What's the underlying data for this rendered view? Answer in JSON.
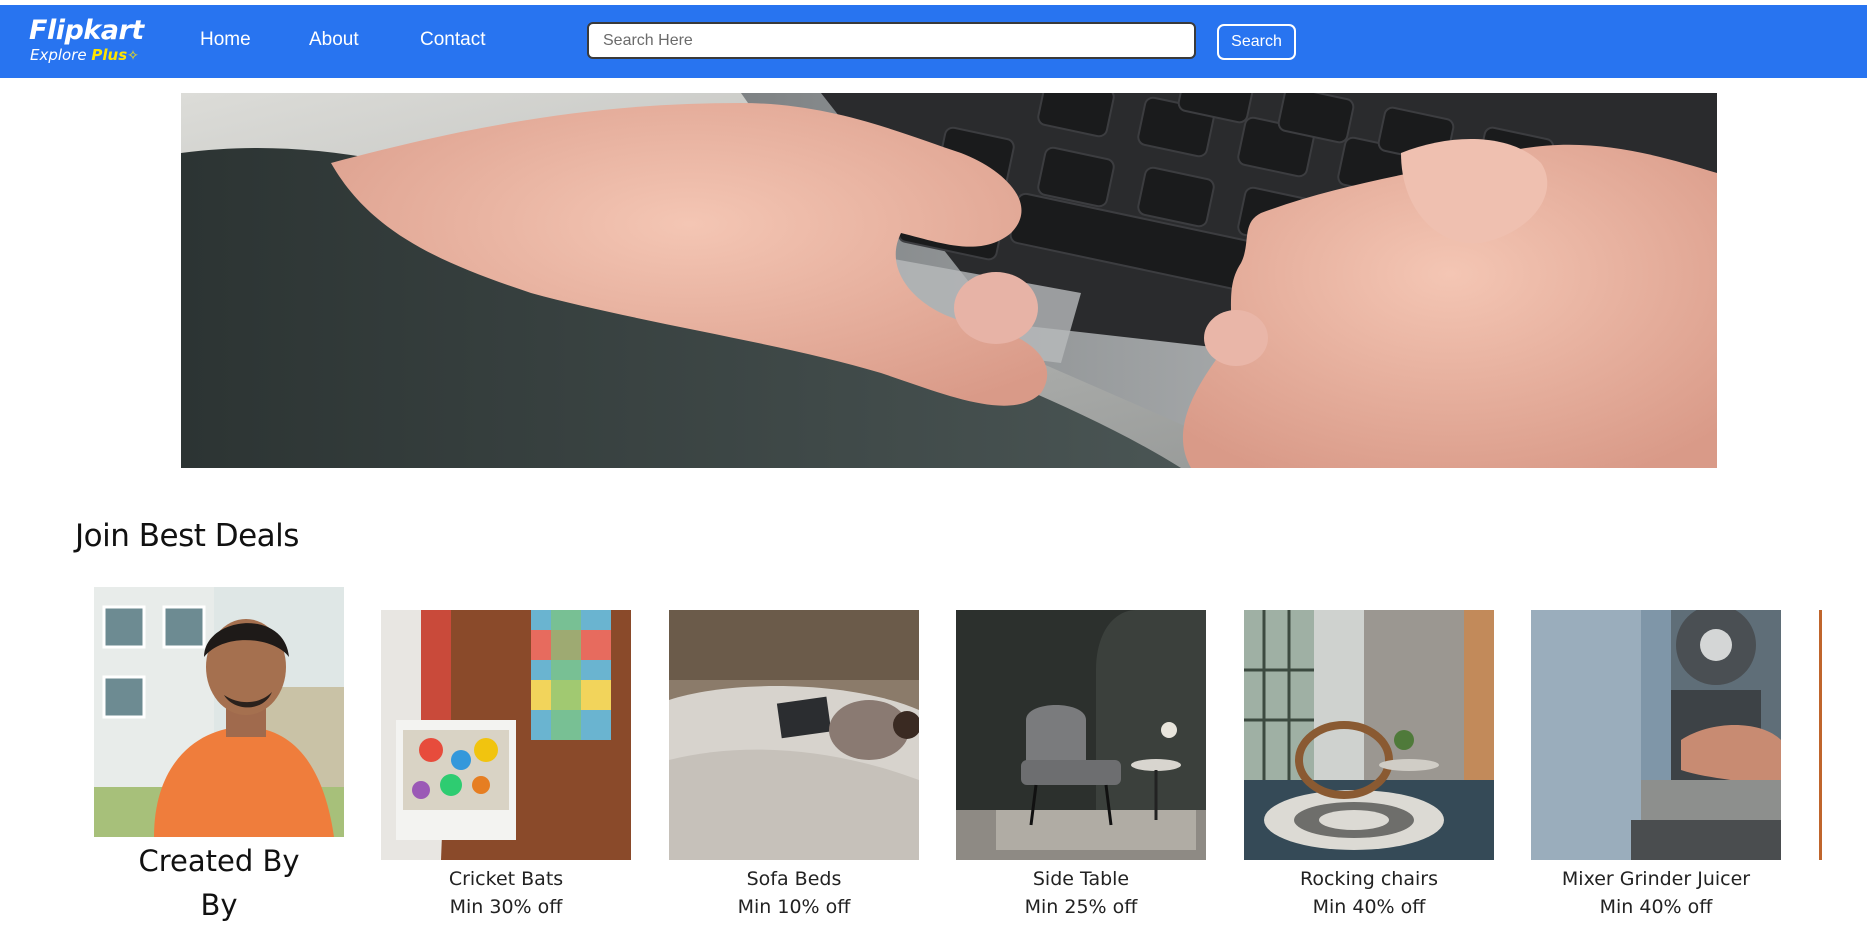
{
  "navbar": {
    "logo_main": "Flipkart",
    "logo_sub_explore": "Explore",
    "logo_sub_plus": "Plus",
    "links": [
      "Home",
      "About",
      "Contact"
    ],
    "search_placeholder": "Search Here",
    "search_button": "Search"
  },
  "section": {
    "title": "Join Best Deals"
  },
  "creator": {
    "line1": "Created By",
    "line2": "By"
  },
  "products": [
    {
      "name": "Cricket Bats",
      "offer": "Min 30% off"
    },
    {
      "name": "Sofa Beds",
      "offer": "Min 10% off"
    },
    {
      "name": "Side Table",
      "offer": "Min 25% off"
    },
    {
      "name": "Rocking chairs",
      "offer": "Min 40% off"
    },
    {
      "name": "Mixer Grinder Juicer",
      "offer": "Min 40% off"
    }
  ],
  "colors": {
    "brand_blue": "#2874f0",
    "plus_yellow": "#ffe500"
  },
  "icons": {
    "plus_badge": "plus-badge-icon"
  }
}
